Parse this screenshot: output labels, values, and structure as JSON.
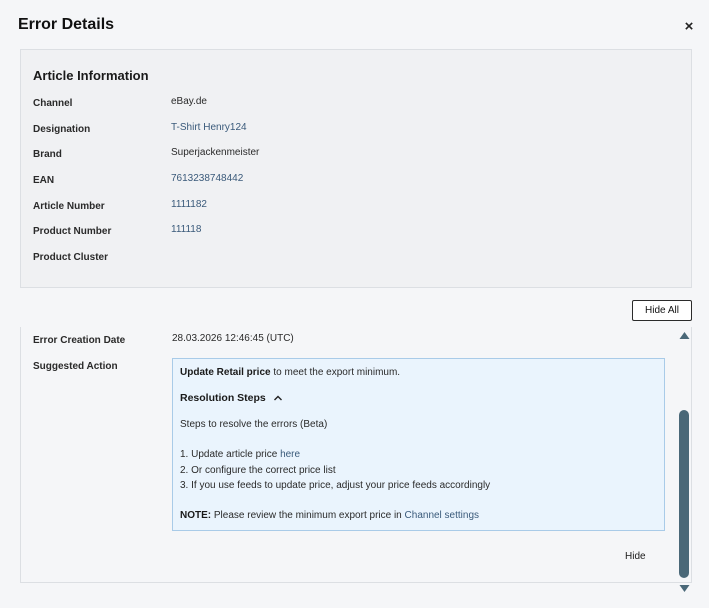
{
  "modal": {
    "title": "Error Details",
    "close_label": "×"
  },
  "article": {
    "title": "Article Information",
    "rows": [
      {
        "label": "Channel",
        "value": "eBay.de"
      },
      {
        "label": "Designation",
        "value": "T-Shirt Henry124"
      },
      {
        "label": "Brand",
        "value": "Superjackenmeister"
      },
      {
        "label": "EAN",
        "value": "7613238748442"
      },
      {
        "label": "Article Number",
        "value": "1111182"
      },
      {
        "label": "Product Number",
        "value": "111118"
      },
      {
        "label": "Product Cluster",
        "value": ""
      }
    ]
  },
  "hide_all_label": "Hide All",
  "error": {
    "creation_date_label": "Error Creation Date",
    "creation_date_value": "28.03.2026 12:46:45 (UTC)",
    "suggested_action_label": "Suggested Action",
    "action": {
      "headline_bold": "Update Retail price",
      "headline_rest": " to meet the export minimum.",
      "steps_title": "Resolution Steps",
      "steps_intro": "Steps to resolve the errors (Beta)",
      "step1_text": "1. Update article price ",
      "step1_link": "here",
      "step2_text": "2. Or configure the correct price list",
      "step3_text": "3. If you use feeds to update price, adjust your price feeds accordingly",
      "note_bold": "NOTE:",
      "note_text": " Please review the minimum export price in ",
      "note_link": "Channel settings"
    },
    "hide_label": "Hide"
  },
  "icons": {
    "close": "close-icon",
    "steps_toggle": "chevron-up-icon",
    "scroll_up": "triangle-up-icon",
    "scroll_down": "triangle-down-icon"
  },
  "colors": {
    "link": "#3a5a7a",
    "action_bg": "#eaf4fd",
    "action_border": "#a9cbe8",
    "scrollbar": "#4a6878"
  }
}
